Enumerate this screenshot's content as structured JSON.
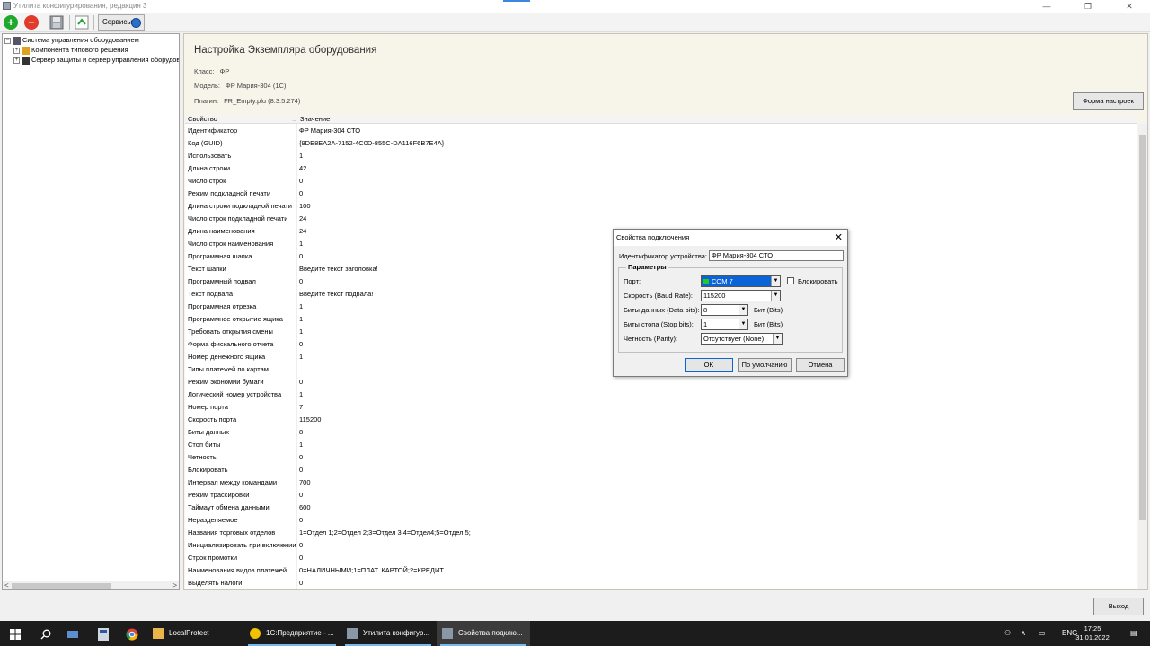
{
  "window": {
    "title": "Утилита конфигурирования, редакция 3",
    "controls": {
      "minimize": "—",
      "maximize": "❐",
      "close": "✕"
    }
  },
  "toolbar": {
    "services_label": "Сервисы"
  },
  "tree": {
    "items": [
      {
        "label": "Система управления оборудованием",
        "expander": "⊟"
      },
      {
        "label": "Компонента типового решения",
        "expander": "+"
      },
      {
        "label": "Сервер защиты и сервер управления оборудов",
        "expander": "+"
      }
    ],
    "scroll_left": "<",
    "scroll_right": ">"
  },
  "main": {
    "heading": "Настройка Экземпляра оборудования",
    "class_label": "Класс:",
    "class_value": "ФР",
    "model_label": "Модель:",
    "model_value": "ФР Мария-304 (1С)",
    "plugin_label": "Плагин:",
    "plugin_value": "FR_Empty.plu (8.3.5.274)",
    "settings_form_button": "Форма настроек",
    "exit_button": "Выход"
  },
  "grid": {
    "col_property": "Свойство",
    "col_value": "Значение",
    "sort_indicator": "..",
    "rows": [
      {
        "k": "Идентификатор",
        "v": "ФР Мария-304 СТО"
      },
      {
        "k": "Код (GUID)",
        "v": "{9DE8EA2A-7152-4C0D-855C-DA116F6B7E4A}"
      },
      {
        "k": "Использовать",
        "v": "1"
      },
      {
        "k": "Длина строки",
        "v": "42"
      },
      {
        "k": "Число строк",
        "v": "0"
      },
      {
        "k": "Режим подкладной печати",
        "v": "0"
      },
      {
        "k": "Длина строки подкладной печати",
        "v": "100"
      },
      {
        "k": "Число строк подкладной печати",
        "v": "24"
      },
      {
        "k": "Длина наименования",
        "v": "24"
      },
      {
        "k": "Число строк наименования",
        "v": "1"
      },
      {
        "k": "Программная шапка",
        "v": "0"
      },
      {
        "k": "Текст шапки",
        "v": "Введите текст заголовка!"
      },
      {
        "k": "Программный подвал",
        "v": "0"
      },
      {
        "k": "Текст подвала",
        "v": "Введите текст подвала!"
      },
      {
        "k": "Программная отрезка",
        "v": "1"
      },
      {
        "k": "Программное открытие ящика",
        "v": "1"
      },
      {
        "k": "Требовать открытия смены",
        "v": "1"
      },
      {
        "k": "Форма фискального отчета",
        "v": "0"
      },
      {
        "k": "Номер денежного ящика",
        "v": "1"
      },
      {
        "k": "Типы платежей по картам",
        "v": ""
      },
      {
        "k": "Режим экономии бумаги",
        "v": "0"
      },
      {
        "k": "Логический номер устройства",
        "v": "1"
      },
      {
        "k": "Номер порта",
        "v": "7"
      },
      {
        "k": "Скорость порта",
        "v": "115200"
      },
      {
        "k": "Биты данных",
        "v": "8"
      },
      {
        "k": "Стоп биты",
        "v": "1"
      },
      {
        "k": "Четность",
        "v": "0"
      },
      {
        "k": "Блокировать",
        "v": "0"
      },
      {
        "k": "Интервал между командами",
        "v": "700"
      },
      {
        "k": "Режим трассировки",
        "v": "0"
      },
      {
        "k": "Таймаут обмена данными",
        "v": "600"
      },
      {
        "k": "Неразделяемое",
        "v": "0"
      },
      {
        "k": "Названия торговых отделов",
        "v": "1=Отдел 1;2=Отдел 2;3=Отдел 3;4=Отдел4;5=Отдел 5;"
      },
      {
        "k": "Инициализировать при включении",
        "v": "0"
      },
      {
        "k": "Строк промотки",
        "v": "0"
      },
      {
        "k": "Наименования видов платежей",
        "v": "0=НАЛИЧНЫМИ;1=ПЛАТ. КАРТОЙ;2=КРЕДИТ"
      },
      {
        "k": "Выделять налоги",
        "v": "0"
      }
    ]
  },
  "dialog": {
    "title": "Свойства подключения",
    "close": "✕",
    "device_id_label": "Идентификатор устройства:",
    "device_id_value": "ФР Мария-304 СТО",
    "group_title": "Параметры",
    "port_label": "Порт:",
    "port_value": "COM 7",
    "block_label": "Блокировать",
    "block_checked": false,
    "baud_label": "Скорость (Baud Rate):",
    "baud_value": "115200",
    "databits_label": "Биты данных (Data bits):",
    "databits_value": "8",
    "databits_unit": "Бит (Bits)",
    "stopbits_label": "Биты стопа (Stop bits):",
    "stopbits_value": "1",
    "stopbits_unit": "Бит (Bits)",
    "parity_label": "Четность (Parity):",
    "parity_value": "Отсутствует (None)",
    "ok": "OK",
    "default": "По умолчанию",
    "cancel": "Отмена",
    "dropdown_arrow": "▼"
  },
  "taskbar": {
    "apps": [
      {
        "label": "LocalProtect"
      },
      {
        "label": "1С:Предприятие - ..."
      },
      {
        "label": "Утилита конфигур..."
      },
      {
        "label": "Свойства подклю..."
      }
    ],
    "lang": "ENG",
    "time": "17:25",
    "date": "31.01.2022"
  },
  "colors": {
    "accent": "#0a64d8",
    "panel_bg": "#f7f4ea",
    "taskbar": "#1c1c1c"
  }
}
